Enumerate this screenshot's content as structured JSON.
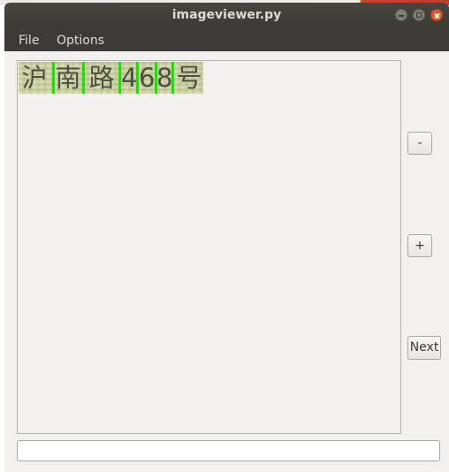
{
  "window": {
    "title": "imageviewer.py"
  },
  "menubar": {
    "items": [
      {
        "label": "File"
      },
      {
        "label": "Options"
      }
    ]
  },
  "image": {
    "characters": [
      "沪",
      "南",
      "路",
      "4",
      "6",
      "8",
      "号"
    ]
  },
  "buttons": {
    "zoom_out_label": "-",
    "zoom_in_label": "+",
    "next_label": "Next"
  },
  "input": {
    "value": ""
  },
  "colors": {
    "titlebar": "#3b3a35",
    "segment_line": "#12e600",
    "close_button": "#e6532a"
  }
}
